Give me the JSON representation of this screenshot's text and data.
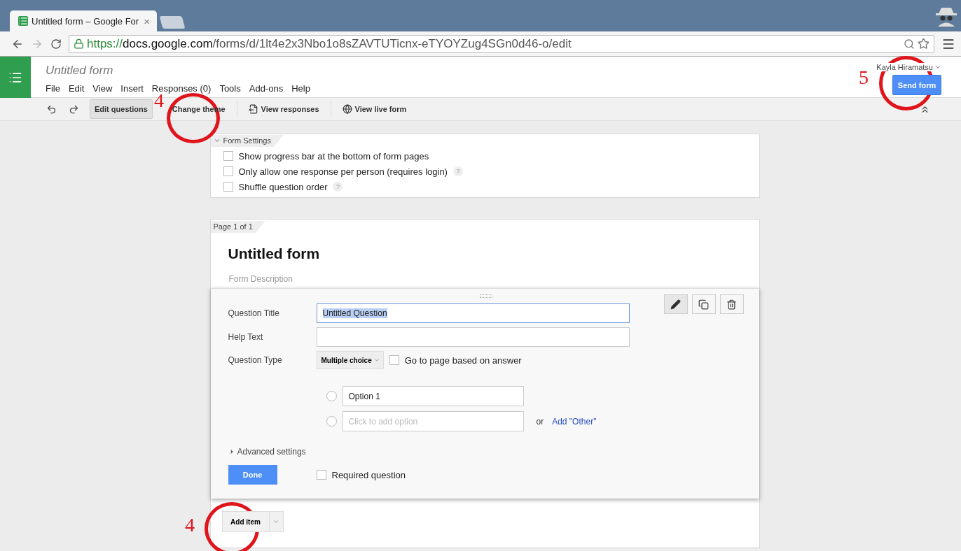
{
  "browser": {
    "tab_title": "Untitled form – Google For",
    "tab_close": "×",
    "url_scheme": "https://",
    "url_host": "docs.google.com",
    "url_path": "/forms/d/1lt4e2x3Nbo1o8sZAVTUTicnx-eTYOYZug4SGn0d46-o/edit"
  },
  "app": {
    "doc_title": "Untitled form",
    "menu": [
      "File",
      "Edit",
      "View",
      "Insert",
      "Responses (0)",
      "Tools",
      "Add-ons",
      "Help"
    ],
    "user": "Kayla Hiramatsu",
    "send_button": "Send form"
  },
  "toolbar": [
    {
      "label": "Edit questions",
      "kind": "plain",
      "selected": true
    },
    {
      "label": "Change theme",
      "kind": "plain",
      "selected": false
    },
    {
      "label": "View responses",
      "kind": "responses",
      "selected": false
    },
    {
      "label": "View live form",
      "kind": "live",
      "selected": false
    }
  ],
  "form_settings": {
    "title": "Form Settings",
    "expanded": true,
    "options": [
      {
        "label": "Show progress bar at the bottom of form pages",
        "checked": false
      },
      {
        "label": "Only allow one response per person (requires login)",
        "checked": false,
        "help": "?"
      },
      {
        "label": "Shuffle question order",
        "checked": false,
        "help": "?"
      }
    ]
  },
  "page": {
    "tab": "Page 1 of 1",
    "title": "Untitled form",
    "description_placeholder": "Form Description"
  },
  "question": {
    "fields": [
      {
        "label": "Question Title",
        "value": "Untitled Question",
        "focused": true
      },
      {
        "label": "Help Text",
        "focused": false
      }
    ],
    "type_label": "Question Type",
    "type_value": "Multiple choice",
    "go_to_page": {
      "label": "Go to page based on answer",
      "checked": false
    },
    "options": [
      {
        "value": "Option 1",
        "selected": false
      },
      {
        "placeholder": "Click to add option",
        "selected": false
      }
    ],
    "or_text": "or",
    "add_other": "Add \"Other\"",
    "advanced": "Advanced settings",
    "done": "Done",
    "required": {
      "label": "Required question",
      "checked": false
    }
  },
  "add_item": "Add item",
  "annotations": [
    {
      "label": "4"
    },
    {
      "label": "5"
    },
    {
      "label": "4"
    }
  ]
}
